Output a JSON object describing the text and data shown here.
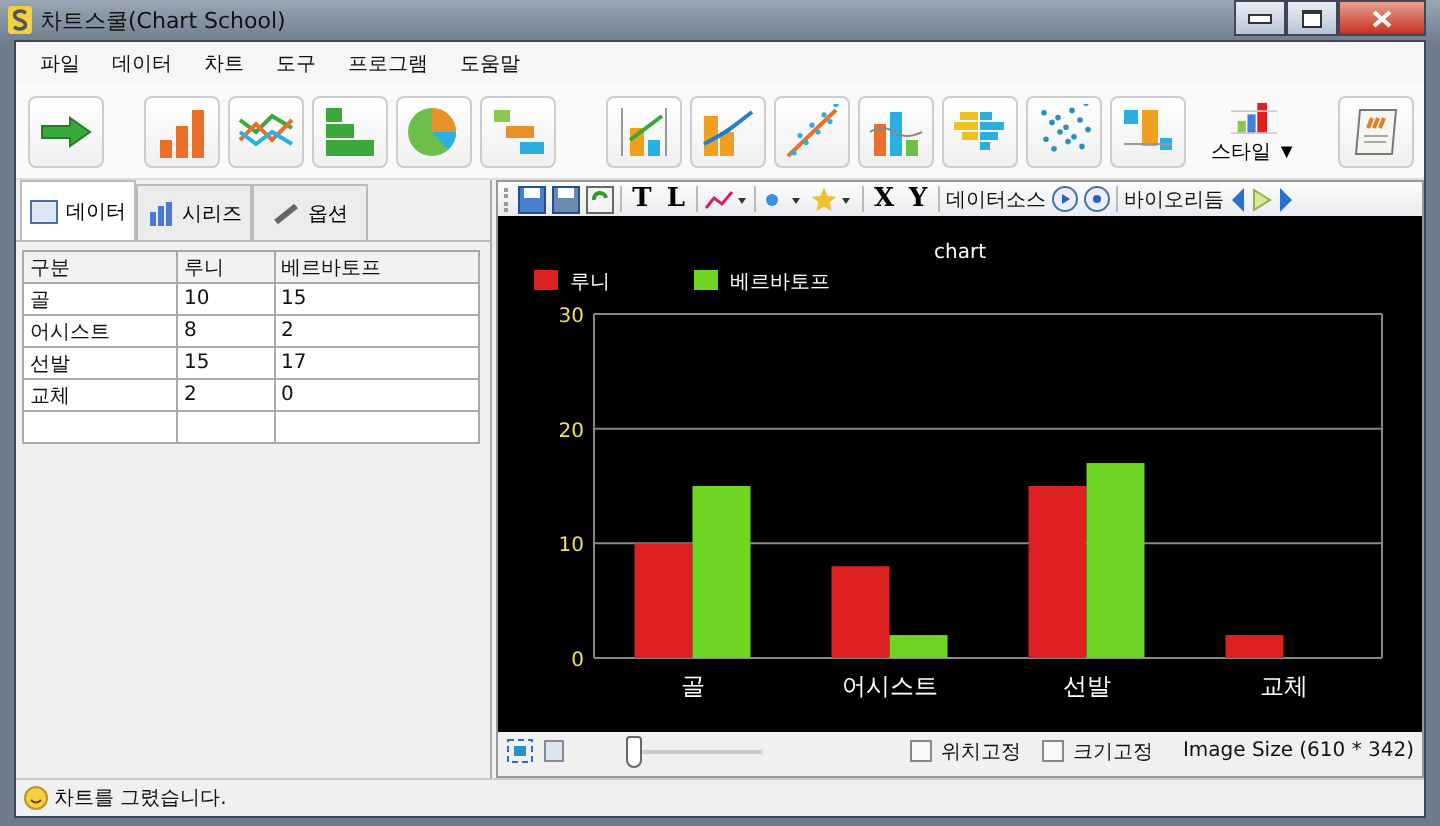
{
  "window": {
    "title": "차트스쿨(Chart School)"
  },
  "menu": [
    "파일",
    "데이터",
    "차트",
    "도구",
    "프로그램",
    "도움말"
  ],
  "toolbar": {
    "style_label": "스타일 ▼"
  },
  "tabs": [
    {
      "label": "데이터",
      "selected": true
    },
    {
      "label": "시리즈",
      "selected": false
    },
    {
      "label": "옵션",
      "selected": false
    }
  ],
  "table": {
    "columns": [
      "구분",
      "루니",
      "베르바토프"
    ],
    "rows": [
      [
        "골",
        "10",
        "15"
      ],
      [
        "어시스트",
        "8",
        "2"
      ],
      [
        "선발",
        "15",
        "17"
      ],
      [
        "교체",
        "2",
        "0"
      ]
    ]
  },
  "chart_toolbar": {
    "title_button": "T",
    "legend_button": "L",
    "x_button": "X",
    "y_button": "Y",
    "data_source": "데이터소스",
    "biorhythm": "바이오리듬"
  },
  "chart": {
    "chart_data": {
      "type": "bar",
      "title": "chart",
      "categories": [
        "골",
        "어시스트",
        "선발",
        "교체"
      ],
      "series": [
        {
          "name": "루니",
          "color": "#dd2020",
          "values": [
            10,
            8,
            15,
            2
          ]
        },
        {
          "name": "베르바토프",
          "color": "#6ed622",
          "values": [
            15,
            2,
            17,
            0
          ]
        }
      ],
      "ylim": [
        0,
        30
      ],
      "yticks": [
        0,
        10,
        20,
        30
      ],
      "legend": "top"
    }
  },
  "bottom_bar": {
    "zoom": {
      "level": 0
    },
    "checkboxes": [
      {
        "label": "위치고정",
        "checked": false
      },
      {
        "label": "크기고정",
        "checked": false
      }
    ],
    "image_size": "Image Size (610 * 342)"
  },
  "status_bar": {
    "text": "차트를 그렸습니다."
  }
}
